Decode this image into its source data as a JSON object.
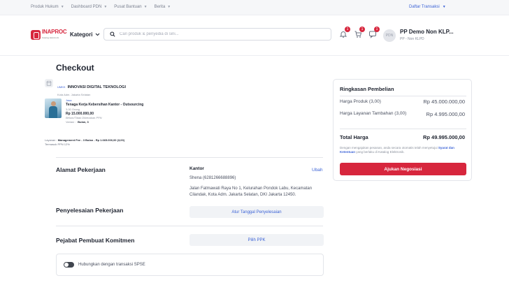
{
  "topbar": {
    "links": [
      {
        "label": "Produk Hukum"
      },
      {
        "label": "Dashboard PDN"
      },
      {
        "label": "Pusat Bantuan"
      },
      {
        "label": "Berita"
      }
    ],
    "daftar_transaksi": "Daftar Transaksi"
  },
  "header": {
    "logo_text": "INAPROC",
    "logo_sub": "Katalog Elektronik",
    "kategori_label": "Kategori",
    "search_placeholder": "Cari produk & penyedia di sini...",
    "badges": {
      "notif": "1",
      "cart": "1",
      "chat": "1"
    },
    "avatar_initials": "PDN",
    "user_name": "PP Demo Non KLP...",
    "user_role": "PP - Non KLPD"
  },
  "checkout": {
    "title": "Checkout",
    "seller": {
      "tag": "UMKK",
      "name": "INNOVASI DIGITAL TEKNOLOGI",
      "location": "Kota Adm. Jakarta Selatan"
    },
    "product": {
      "type": "Jasa",
      "name": "Tenaga Kerja Kebersihan Kantor - Outsourcing",
      "qty": "3,00 Orang",
      "price": "Rp 15.000.000,00",
      "note": "Belum/Tidak Dikenakan PPN",
      "variasi_label": "Variasi :",
      "variasi_value": "Bulan, 3"
    },
    "layanan": {
      "label": "Layanan :",
      "value": "Management Fee - 3 Bulan - Rp 1.665.000,00 (3,00)",
      "tax": "Termasuk PPN 12%"
    },
    "alamat": {
      "title": "Alamat Pekerjaan",
      "place": "Kantor",
      "edit": "Ubah",
      "contact": "Shena (6281266688896)",
      "address": "Jalan Fatmawati Raya No 1, Kelurahan Pondok Labu, Kecamatan Cilandak, Kota Adm. Jakarta Selatan, DKI Jakarta 12450."
    },
    "penyelesaian": {
      "title": "Penyelesaian Pekerjaan",
      "button": "Atur Tanggal Penyelesaian"
    },
    "ppk": {
      "title": "Pejabat Pembuat Komitmen",
      "button": "Pilih PPK"
    },
    "spse": {
      "label": "Hubungkan dengan transaksi SPSE",
      "enabled": false
    }
  },
  "summary": {
    "title": "Ringkasan Pembelian",
    "rows": [
      {
        "label": "Harga Produk (3,00)",
        "value": "Rp 45.000.000,00"
      },
      {
        "label": "Harga Layanan Tambahan (3,00)",
        "value": "Rp 4.995.000,00"
      }
    ],
    "total_label": "Total Harga",
    "total_value": "Rp 49.995.000,00",
    "terms_pre": "Dengan mengajukan pesanan, anda secara otomatis telah menyetujui",
    "terms_link": "Syarat dan Ketentuan",
    "terms_post": "yang berlaku di Katalog Elektronik.",
    "cta": "Ajukan Negosiasi"
  },
  "colors": {
    "brand_red": "#d7263d",
    "link_blue": "#3c63d6",
    "text_dark": "#1f2430",
    "border": "#e3e5ea"
  }
}
